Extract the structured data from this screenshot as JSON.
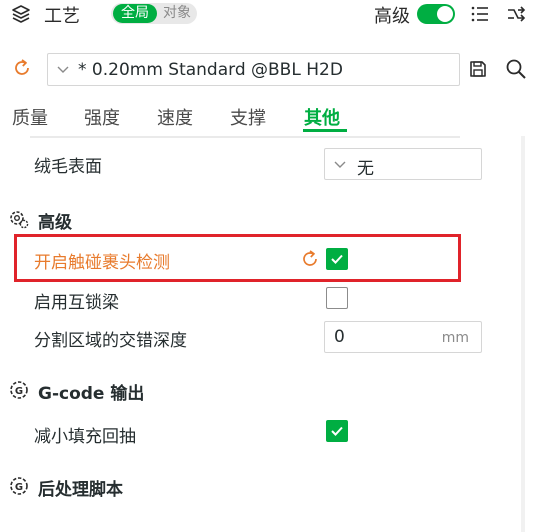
{
  "header": {
    "title": "工艺",
    "scope_global": "全局",
    "scope_object": "对象",
    "advanced_label": "高级",
    "advanced_enabled": true
  },
  "preset": {
    "name": "* 0.20mm Standard @BBL H2D"
  },
  "tabs": [
    {
      "label": "质量",
      "active": false
    },
    {
      "label": "强度",
      "active": false
    },
    {
      "label": "速度",
      "active": false
    },
    {
      "label": "支撑",
      "active": false
    },
    {
      "label": "其他",
      "active": true
    }
  ],
  "settings": {
    "fuzzy_skin": {
      "label": "绒毛表面",
      "value": "无"
    },
    "advanced_section": {
      "title": "高级"
    },
    "nozzle_clump_detection": {
      "label": "开启触碰裹头检测",
      "checked": true,
      "modified": true
    },
    "interlocking_beam": {
      "label": "启用互锁梁",
      "checked": false
    },
    "interlocking_depth": {
      "label": "分割区域的交错深度",
      "value": "0",
      "unit": "mm"
    },
    "gcode_section": {
      "title": "G-code 输出"
    },
    "reduce_infill_retraction": {
      "label": "减小填充回抽",
      "checked": true
    },
    "post_process_section": {
      "title": "后处理脚本"
    }
  },
  "colors": {
    "accent": "#00ae42",
    "highlight": "#e0232a",
    "modified_text": "#e87b2d"
  }
}
